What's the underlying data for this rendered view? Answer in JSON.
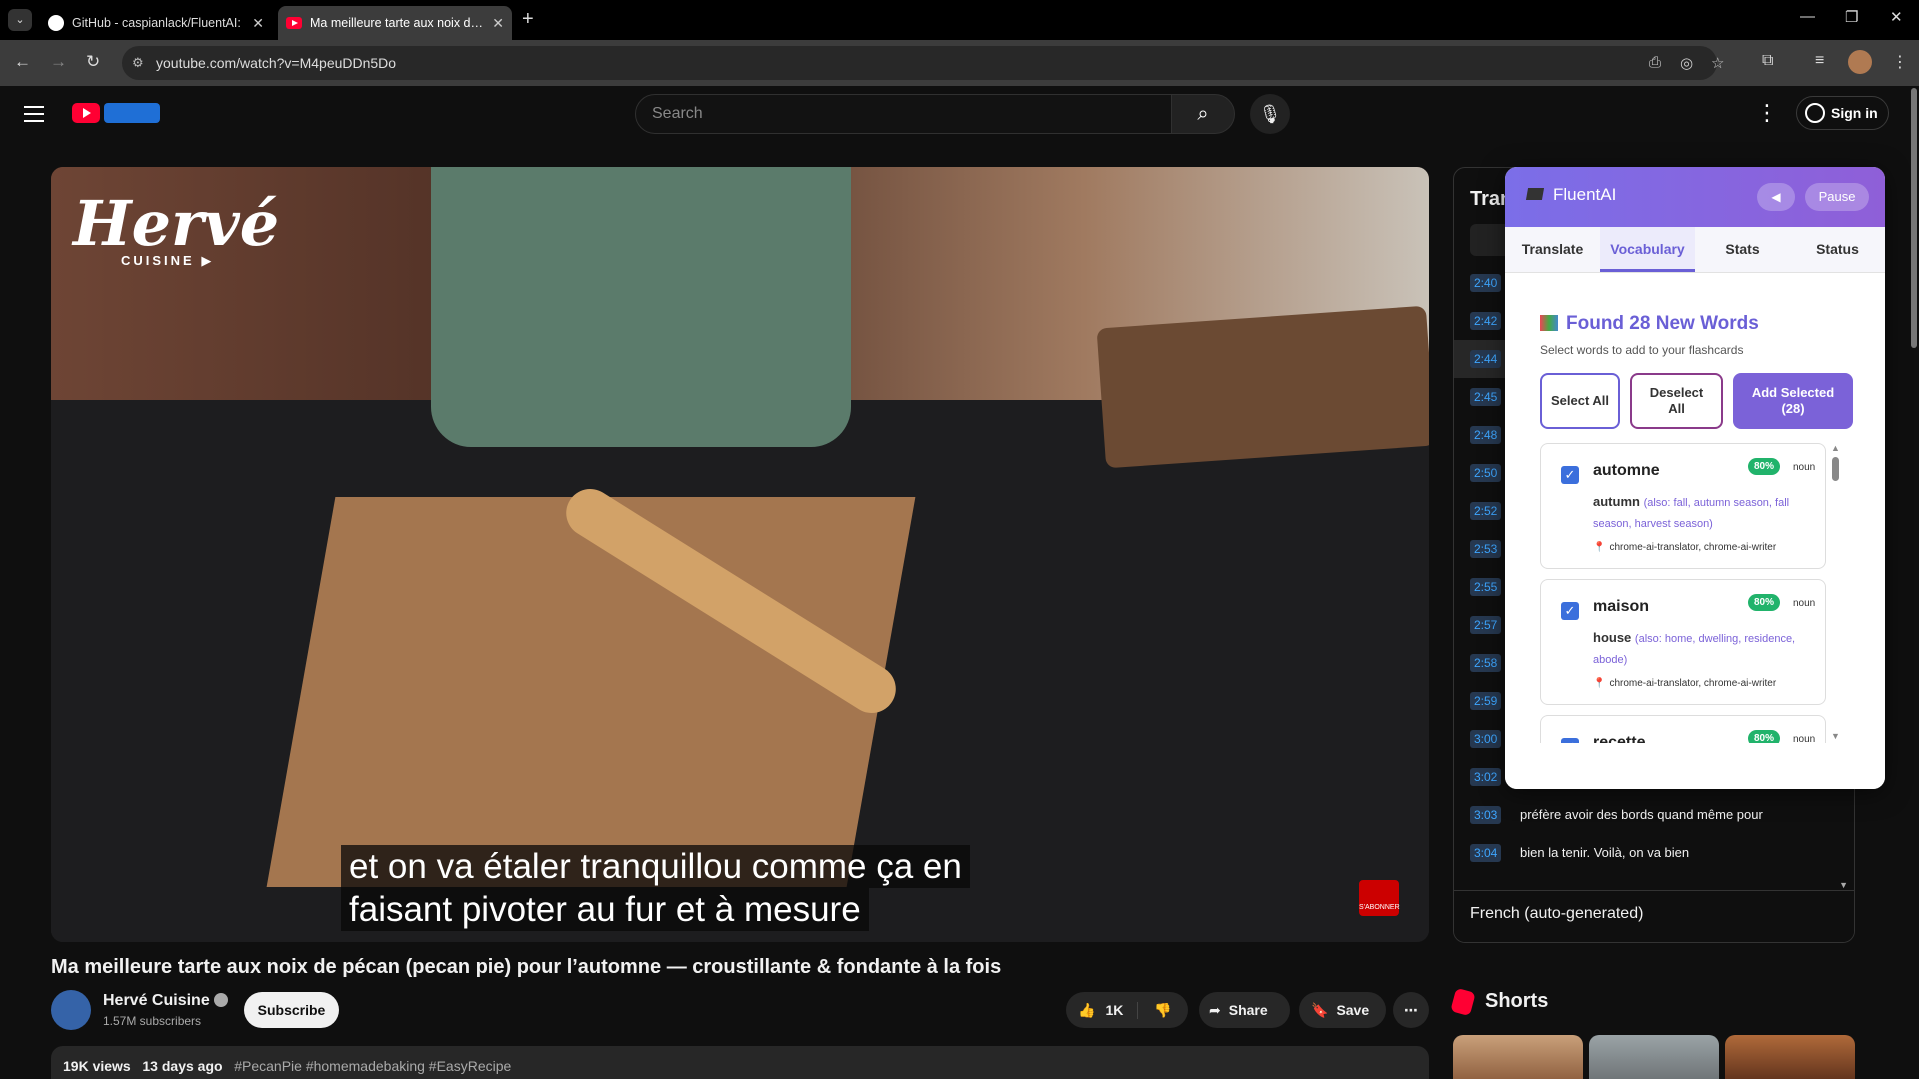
{
  "browser": {
    "tabs": [
      {
        "title": "GitHub - caspianlack/FluentAI: "
      },
      {
        "title": "Ma meilleure tarte aux noix de pécan"
      }
    ],
    "url": "youtube.com/watch?v=M4peuDDn5Do"
  },
  "youtube": {
    "search_placeholder": "Search",
    "sign_in": "Sign in"
  },
  "video": {
    "logo_text": "Hervé",
    "logo_sub": "CUISINE ▶",
    "subtitle_line1": "et on va étaler tranquillou comme ça en",
    "subtitle_line2": "faisant pivoter au fur et à mesure",
    "subscribe_badge": "S'ABONNER",
    "title": "Ma meilleure tarte aux noix de pécan (pecan pie) pour l’automne — croustillante & fondante à la fois",
    "channel": "Hervé Cuisine",
    "subscribers": "1.57M subscribers",
    "subscribe_label": "Subscribe",
    "likes": "1K",
    "share_label": "Share",
    "save_label": "Save",
    "views": "19K views",
    "age": "13 days ago",
    "hashtags": "#PecanPie #homemadebaking #EasyRecipe"
  },
  "transcript": {
    "title": "Tran",
    "rows": [
      {
        "time": "2:40",
        "text": ""
      },
      {
        "time": "2:42",
        "text": ""
      },
      {
        "time": "2:44",
        "text": ""
      },
      {
        "time": "2:45",
        "text": ""
      },
      {
        "time": "2:48",
        "text": ""
      },
      {
        "time": "2:50",
        "text": ""
      },
      {
        "time": "2:52",
        "text": ""
      },
      {
        "time": "2:53",
        "text": ""
      },
      {
        "time": "2:55",
        "text": ""
      },
      {
        "time": "2:57",
        "text": ""
      },
      {
        "time": "2:58",
        "text": ""
      },
      {
        "time": "2:59",
        "text": ""
      },
      {
        "time": "3:00",
        "text": ""
      },
      {
        "time": "3:02",
        "text": ""
      },
      {
        "time": "3:03",
        "text": "préfère avoir des bords quand même pour"
      },
      {
        "time": "3:04",
        "text": "bien la tenir. Voilà, on va bien"
      }
    ],
    "language": "French (auto-generated)"
  },
  "fluentai": {
    "title": "FluentAI",
    "back_label": "◀",
    "pause_label": "Pause",
    "tabs": [
      "Translate",
      "Vocabulary",
      "Stats",
      "Status"
    ],
    "active_tab": "Vocabulary",
    "found_heading": "Found 28 New Words",
    "found_sub": "Select words to add to your flashcards",
    "btn_select_all": "Select All",
    "btn_deselect_all": "Deselect All",
    "btn_add_selected": "Add Selected (28)",
    "words": [
      {
        "word": "automne",
        "confidence": "80%",
        "pos": "noun",
        "translation": "autumn",
        "alternatives": "(also: fall, autumn season, fall season, harvest season)",
        "sources": "chrome-ai-translator, chrome-ai-writer"
      },
      {
        "word": "maison",
        "confidence": "80%",
        "pos": "noun",
        "translation": "house",
        "alternatives": "(also: home, dwelling, residence, abode)",
        "sources": "chrome-ai-translator, chrome-ai-writer"
      },
      {
        "word": "recette",
        "confidence": "80%",
        "pos": "noun",
        "translation": "",
        "alternatives": "",
        "sources": ""
      }
    ],
    "accent_color": "#6a5fd6",
    "confidence_color": "#21b36b"
  },
  "shorts": {
    "title": "Shorts"
  }
}
